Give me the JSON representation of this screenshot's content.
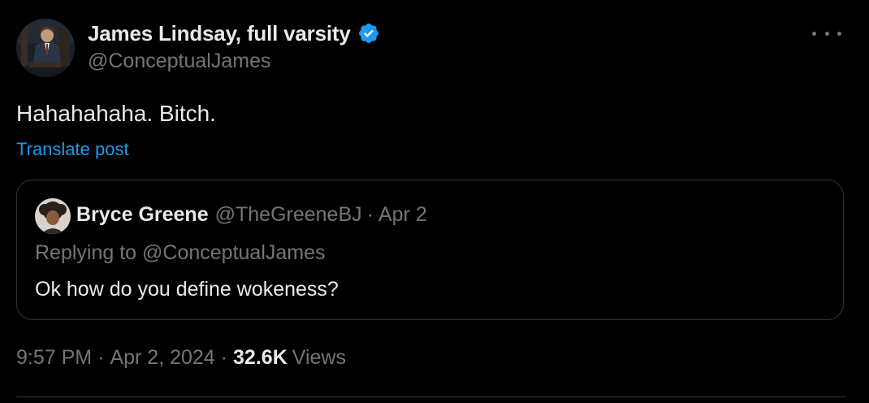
{
  "author": {
    "display_name": "James Lindsay, full varsity",
    "handle": "@ConceptualJames",
    "verified": true
  },
  "more_icon": "more-horizontal-icon",
  "tweet": {
    "text": "Hahahahaha. Bitch.",
    "translate_label": "Translate post"
  },
  "quoted": {
    "display_name": "Bryce Greene",
    "handle": "@TheGreeneBJ",
    "separator": "·",
    "date": "Apr 2",
    "replying_to": "Replying to @ConceptualJames",
    "text": "Ok how do you define wokeness?"
  },
  "meta": {
    "time": "9:57 PM",
    "separator": "·",
    "date": "Apr 2, 2024",
    "views_count": "32.6K",
    "views_label": "Views"
  },
  "colors": {
    "background": "#000000",
    "text_primary": "#e7e9ea",
    "text_secondary": "#71767b",
    "link": "#1d9bf0",
    "border": "#2f3336",
    "verified_badge": "#1d9bf0"
  }
}
